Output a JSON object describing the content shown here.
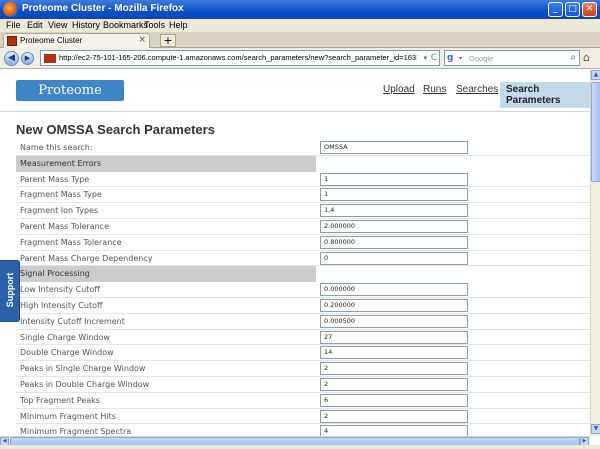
{
  "window": {
    "title": "Proteome Cluster - Mozilla Firefox",
    "controls": [
      "_",
      "□",
      "✕"
    ]
  },
  "menu": [
    "File",
    "Edit",
    "View",
    "History",
    "Bookmarks",
    "Tools",
    "Help"
  ],
  "tab": {
    "title": "Proteome Cluster",
    "close": "×",
    "new_tab": "+"
  },
  "navbar": {
    "back": "◀",
    "forward": "▶",
    "url": "http://ec2-75-101-165-206.compute-1.amazonaws.com/search_parameters/new?search_parameter_id=163",
    "star": "☆",
    "dropdown": "▾",
    "reload": "C",
    "search_engine": "g",
    "search_placeholder": "Google",
    "search_icon": "⌕",
    "home": "⌂"
  },
  "page": {
    "logo": "Proteome Cluster",
    "nav": [
      "Upload",
      "Runs",
      "Searches",
      "Search Parameters"
    ],
    "heading": "New OMSSA Search Parameters",
    "support": "Support"
  },
  "form": {
    "rows": [
      {
        "type": "field",
        "label": "Name this search:",
        "value": "OMSSA"
      },
      {
        "type": "section",
        "label": "Measurement Errors"
      },
      {
        "type": "field",
        "label": "Parent Mass Type",
        "value": "1"
      },
      {
        "type": "field",
        "label": "Fragment Mass Type",
        "value": "1"
      },
      {
        "type": "field",
        "label": "Fragment Ion Types",
        "value": "1,4"
      },
      {
        "type": "field",
        "label": "Parent Mass Tolerance",
        "value": "2.000000"
      },
      {
        "type": "field",
        "label": "Fragment Mass Tolerance",
        "value": "0.800000"
      },
      {
        "type": "field",
        "label": "Parent Mass Charge Dependency",
        "value": "0"
      },
      {
        "type": "section",
        "label": "Signal Processing"
      },
      {
        "type": "field",
        "label": "Low Intensity Cutoff",
        "value": "0.000000"
      },
      {
        "type": "field",
        "label": "High Intensity Cutoff",
        "value": "0.200000"
      },
      {
        "type": "field",
        "label": "Intensity Cutoff Increment",
        "value": "0.000500"
      },
      {
        "type": "field",
        "label": "Single Charge Window",
        "value": "27"
      },
      {
        "type": "field",
        "label": "Double Charge Window",
        "value": "14"
      },
      {
        "type": "field",
        "label": "Peaks in Single Charge Window",
        "value": "2"
      },
      {
        "type": "field",
        "label": "Peaks in Double Charge Window",
        "value": "2"
      },
      {
        "type": "field",
        "label": "Top Fragment Peaks",
        "value": "6"
      },
      {
        "type": "field",
        "label": "Minimum Fragment Hits",
        "value": "2"
      },
      {
        "type": "field",
        "label": "Minimum Fragment Spectra",
        "value": "4"
      }
    ]
  },
  "scroll": {
    "up": "▲",
    "down": "▼",
    "left": "◀",
    "right": "▶"
  }
}
